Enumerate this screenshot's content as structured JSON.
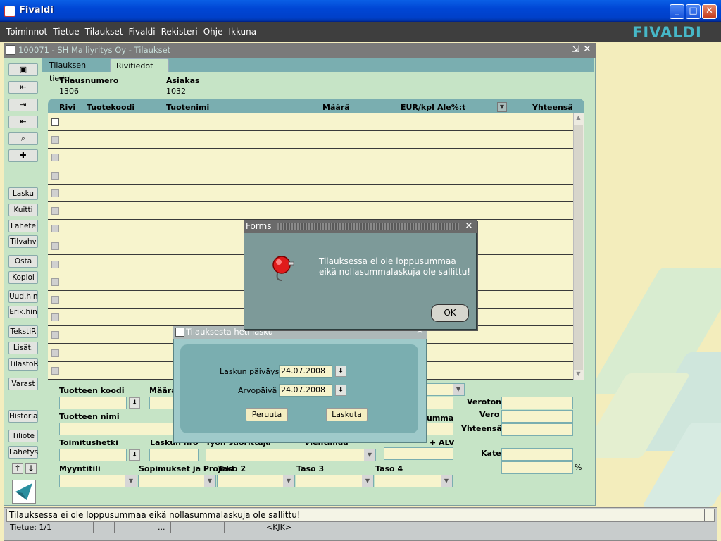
{
  "window": {
    "title": "Fivaldi",
    "min": "_",
    "max": "□",
    "close": "✕"
  },
  "menu": [
    "Toiminnot",
    "Tietue",
    "Tilaukset",
    "Fivaldi",
    "Rekisteri",
    "Ohje",
    "Ikkuna"
  ],
  "logo": "FIVALDI",
  "inner_window": {
    "title": "100071 - SH Malliyritys Oy - Tilaukset",
    "min": "⇲",
    "close": "✕"
  },
  "tabs": [
    "Tilauksen tiedot",
    "Rivitiedot"
  ],
  "header": {
    "tilausnumero_label": "Tilausnumero",
    "tilausnumero": "1306",
    "asiakas_label": "Asiakas",
    "asiakas": "1032"
  },
  "left_buttons": [
    "Lasku",
    "Kuitti",
    "Lähete",
    "Tilvahv",
    "Osta",
    "Kopioi",
    "Uud.hin",
    "Erik.hin",
    "TekstiR",
    "Lisät.",
    "TilastoR",
    "Varast",
    "Historia",
    "Tiliote",
    "Lähetys"
  ],
  "grid": {
    "columns": [
      "Rivi",
      "Tuotekoodi",
      "Tuotenimi",
      "Määrä",
      "EUR/kpl",
      "Ale%:t",
      "Yhteensä"
    ]
  },
  "lower": {
    "tuotteen_koodi": "Tuotteen koodi",
    "maara": "Määrä",
    "tuotteen_nimi": "Tuotteen nimi",
    "toimitushetki": "Toimitushetki",
    "laskun_nro": "Laskun nro",
    "tyon_suorittaja": "Työn suorittaja",
    "vientimaa": "Vientimaa",
    "summa": "umma",
    "alv": "+ ALV",
    "veroton": "Veroton",
    "vero": "Vero",
    "yhteensa": "Yhteensä",
    "kate": "Kate",
    "percent": "%",
    "myyntitili": "Myyntitili",
    "sopimukset": "Sopimukset ja Projekt",
    "taso2": "Taso 2",
    "taso3": "Taso 3",
    "taso4": "Taso 4"
  },
  "forms_dialog": {
    "title": "Forms",
    "message": "Tilauksessa ei ole loppusummaa eikä nollasummalaskuja ole sallittu!",
    "ok": "OK",
    "close": "✕"
  },
  "lasku_dialog": {
    "title": "Tilauksesta heti lasku",
    "close": "✕",
    "laskun_paivays_label": "Laskun päiväys",
    "laskun_paivays": "24.07.2008",
    "arvopaiva_label": "Arvopäivä",
    "arvopaiva": "24.07.2008",
    "peruuta": "Peruuta",
    "laskuta": "Laskuta"
  },
  "status": {
    "message": "Tilauksessa ei ole loppusummaa eikä nollasummalaskuja ole sallittu!",
    "record": "Tietue: 1/1",
    "dots": "...",
    "kjk": "<KJK>"
  }
}
